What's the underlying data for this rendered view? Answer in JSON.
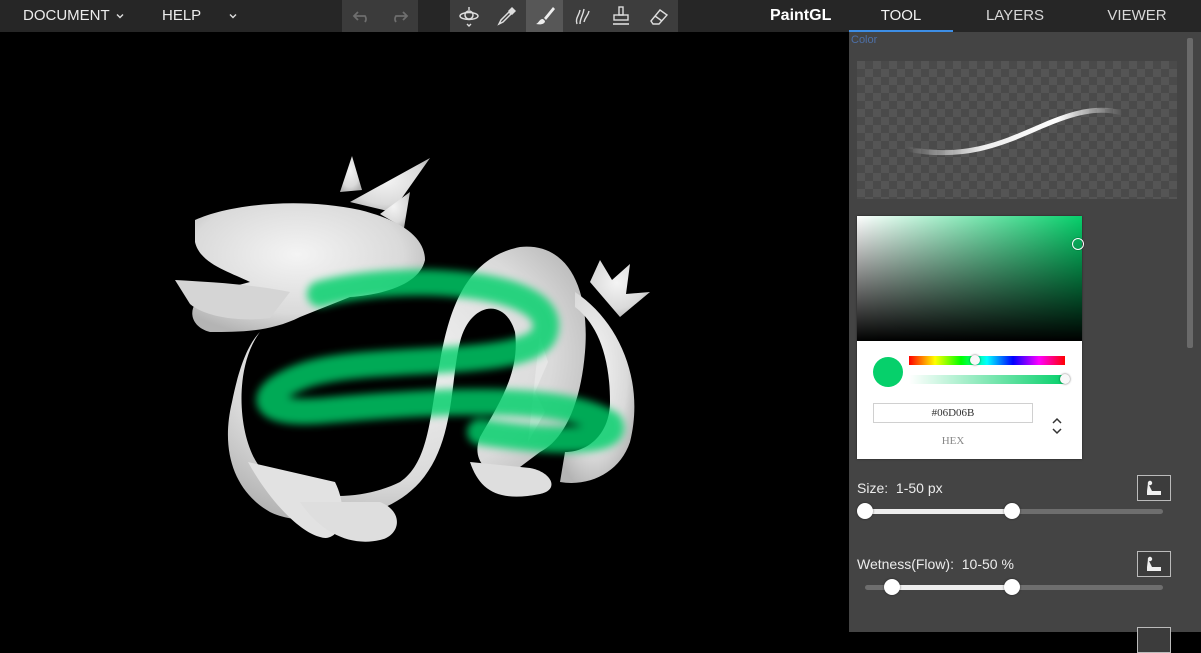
{
  "menu": {
    "document_label": "DOCUMENT",
    "help_label": "HELP"
  },
  "toolbar": {
    "undo_icon": "undo-icon",
    "redo_icon": "redo-icon",
    "tools": [
      "rotate-view-icon",
      "eyedropper-icon",
      "brush-icon",
      "smudge-icon",
      "stamp-icon",
      "eraser-icon"
    ],
    "active_tool": "brush-icon"
  },
  "app": {
    "title": "PaintGL"
  },
  "panel": {
    "tabs": [
      {
        "label": "TOOL",
        "active": true
      },
      {
        "label": "LAYERS",
        "active": false
      },
      {
        "label": "VIEWER",
        "active": false
      }
    ],
    "faint_label": "Color"
  },
  "color": {
    "hex_value": "#06D06B",
    "mode_label": "HEX",
    "swatch_color": "#06d06b",
    "hue_fraction": 0.42,
    "alpha_fraction": 1.0
  },
  "size": {
    "label": "Size:",
    "range_text": "1-50 px",
    "min": 1,
    "max": 50
  },
  "wetness": {
    "label": "Wetness(Flow):",
    "range_text": "10-50 %",
    "min": 10,
    "max": 50
  },
  "colors": {
    "accent": "#3d8ee6",
    "paint": "#06d06b",
    "panel_bg": "#444444",
    "topbar_bg": "#262626"
  }
}
